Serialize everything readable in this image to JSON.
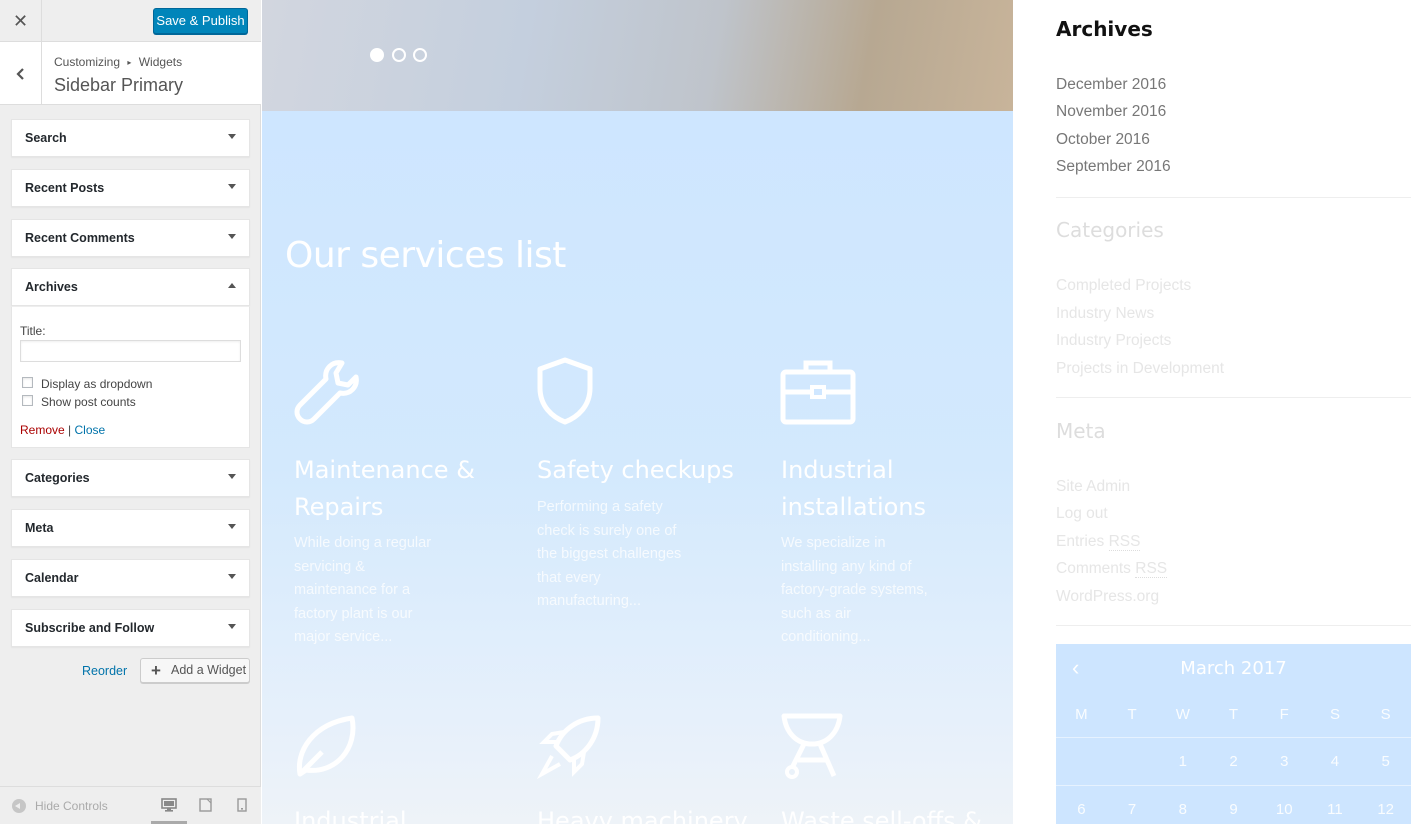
{
  "customizer": {
    "close_label": "✕",
    "save_label": "Save & Publish",
    "breadcrumb": {
      "parent": "Customizing",
      "separator": "▸",
      "current": "Widgets"
    },
    "section_title": "Sidebar Primary",
    "widgets": [
      {
        "title": "Search"
      },
      {
        "title": "Recent Posts"
      },
      {
        "title": "Recent Comments"
      },
      {
        "title": "Archives"
      },
      {
        "title": "Categories"
      },
      {
        "title": "Meta"
      },
      {
        "title": "Calendar"
      },
      {
        "title": "Subscribe and Follow"
      }
    ],
    "archives_form": {
      "title_label": "Title:",
      "title_value": "",
      "dropdown_label": "Display as dropdown",
      "dropdown_checked": false,
      "counts_label": "Show post counts",
      "counts_checked": false,
      "remove_label": "Remove",
      "separator": "|",
      "close_label": "Close"
    },
    "reorder_label": "Reorder",
    "add_widget_label": "Add a Widget",
    "hide_controls_label": "Hide Controls",
    "device_icons": [
      "desktop-icon",
      "tablet-icon",
      "mobile-icon"
    ],
    "active_device": "desktop"
  },
  "preview": {
    "slider_dots": 3,
    "active_slide": 1,
    "services_title": "Our services list",
    "services": [
      {
        "icon": "wrench-icon",
        "title_line1": "Maintenance &",
        "title_line2": "Repairs",
        "text": [
          "While doing a regular",
          "servicing &",
          "maintenance for a",
          "factory plant is our",
          "major service..."
        ]
      },
      {
        "icon": "shield-icon",
        "title_line1": "Safety checkups",
        "title_line2": "",
        "text": [
          "Performing a safety",
          "check is surely one of",
          "the biggest challenges",
          "that every",
          "manufacturing..."
        ]
      },
      {
        "icon": "briefcase-icon",
        "title_line1": "Industrial",
        "title_line2": "installations",
        "text": [
          "We specialize in",
          "installing any kind of",
          "factory-grade systems,",
          "such as air",
          "conditioning..."
        ]
      },
      {
        "icon": "leaf-icon",
        "title_line1": "Industrial",
        "title_line2": "",
        "text": []
      },
      {
        "icon": "rocket-icon",
        "title_line1": "Heavy machinery",
        "title_line2": "",
        "text": []
      },
      {
        "icon": "grill-icon",
        "title_line1": "Waste sell-offs &",
        "title_line2": "",
        "text": []
      }
    ]
  },
  "sidebar": {
    "archives": {
      "heading": "Archives",
      "items": [
        "December 2016",
        "November 2016",
        "October 2016",
        "September 2016"
      ]
    },
    "categories": {
      "heading": "Categories",
      "items": [
        "Completed Projects",
        "Industry News",
        "Industry Projects",
        "Projects in Development"
      ]
    },
    "meta": {
      "heading": "Meta",
      "items": [
        {
          "text": "Site Admin"
        },
        {
          "text": "Log out"
        },
        {
          "text": "Entries ",
          "abbr": "RSS"
        },
        {
          "text": "Comments ",
          "abbr": "RSS"
        },
        {
          "text": "WordPress.org"
        }
      ]
    },
    "calendar": {
      "prev": "‹",
      "month": "March 2017",
      "weekdays": [
        "M",
        "T",
        "W",
        "T",
        "F",
        "S",
        "S"
      ],
      "weeks": [
        [
          "",
          "",
          "1",
          "2",
          "3",
          "4",
          "5"
        ],
        [
          "6",
          "7",
          "8",
          "9",
          "10",
          "11",
          "12"
        ]
      ]
    }
  },
  "colors": {
    "primary_button": "#0085ba",
    "link": "#0073aa",
    "remove": "#aa0000",
    "services_bg": "#d0e7ff"
  }
}
